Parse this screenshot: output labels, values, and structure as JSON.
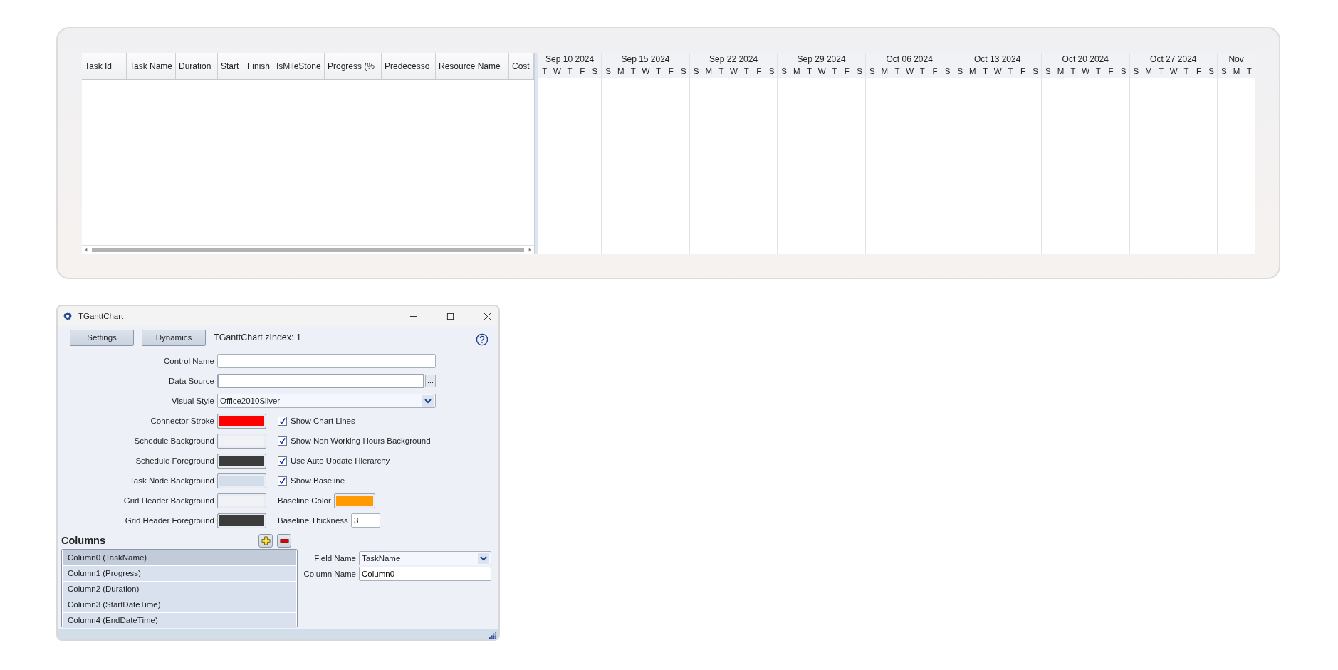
{
  "gantt": {
    "grid_columns": [
      {
        "label": "Task Id"
      },
      {
        "label": "Task Name"
      },
      {
        "label": "Duration"
      },
      {
        "label": "Start"
      },
      {
        "label": "Finish"
      },
      {
        "label": "IsMileStone"
      },
      {
        "label": "Progress (%"
      },
      {
        "label": "Predecesso"
      },
      {
        "label": "Resource Name"
      },
      {
        "label": "Cost"
      }
    ],
    "weeks": [
      {
        "label": "Sep 10 2024",
        "days": [
          "T",
          "W",
          "T",
          "F",
          "S"
        ]
      },
      {
        "label": "Sep 15 2024",
        "days": [
          "S",
          "M",
          "T",
          "W",
          "T",
          "F",
          "S"
        ]
      },
      {
        "label": "Sep 22 2024",
        "days": [
          "S",
          "M",
          "T",
          "W",
          "T",
          "F",
          "S"
        ]
      },
      {
        "label": "Sep 29 2024",
        "days": [
          "S",
          "M",
          "T",
          "W",
          "T",
          "F",
          "S"
        ]
      },
      {
        "label": "Oct 06 2024",
        "days": [
          "S",
          "M",
          "T",
          "W",
          "T",
          "F",
          "S"
        ]
      },
      {
        "label": "Oct 13 2024",
        "days": [
          "S",
          "M",
          "T",
          "W",
          "T",
          "F",
          "S"
        ]
      },
      {
        "label": "Oct 20 2024",
        "days": [
          "S",
          "M",
          "T",
          "W",
          "T",
          "F",
          "S"
        ]
      },
      {
        "label": "Oct 27 2024",
        "days": [
          "S",
          "M",
          "T",
          "W",
          "T",
          "F",
          "S"
        ]
      },
      {
        "label": "Nov",
        "days": [
          "S",
          "M",
          "T"
        ]
      }
    ]
  },
  "dialog": {
    "title": "TGanttChart",
    "buttons": [
      "Settings",
      "Dynamics"
    ],
    "info": "TGanttChart zIndex: 1",
    "fields": [
      {
        "kind": "text",
        "label": "Control Name"
      },
      {
        "kind": "browse",
        "label": "Data Source",
        "button": "..."
      },
      {
        "kind": "select",
        "label": "Visual Style",
        "value": "Office2010Silver"
      }
    ],
    "rows": [
      {
        "label": "Connector Stroke",
        "color": "#ff0000",
        "right": {
          "kind": "checkbox",
          "label": "Show Chart Lines",
          "checked": true
        }
      },
      {
        "label": "Schedule Background",
        "color": "#f0f2f5",
        "right": {
          "kind": "checkbox",
          "label": "Show Non Working Hours Background",
          "checked": true
        }
      },
      {
        "label": "Schedule Foreground",
        "color": "#3c3c3c",
        "right": {
          "kind": "checkbox",
          "label": "Use Auto Update Hierarchy",
          "checked": true
        }
      },
      {
        "label": "Task Node Background",
        "color": "#d3dde9",
        "right": {
          "kind": "checkbox",
          "label": "Show Baseline",
          "checked": true
        }
      },
      {
        "label": "Grid Header Background",
        "color": "#f0f2f5",
        "right": {
          "kind": "color",
          "label": "Baseline Color",
          "color": "#ff9a00"
        }
      },
      {
        "label": "Grid Header Foreground",
        "color": "#3c3c3c",
        "right": {
          "kind": "number",
          "label": "Baseline Thickness",
          "value": "3"
        }
      }
    ],
    "columns": {
      "title": "Columns",
      "items": [
        {
          "label": "Column0 (TaskName)",
          "selected": true
        },
        {
          "label": "Column1 (Progress)",
          "selected": false
        },
        {
          "label": "Column2 (Duration)",
          "selected": false
        },
        {
          "label": "Column3 (StartDateTime)",
          "selected": false
        },
        {
          "label": "Column4 (EndDateTime)",
          "selected": false
        }
      ],
      "field_name": {
        "label": "Field Name",
        "value": "TaskName"
      },
      "column_name": {
        "label": "Column Name",
        "value": "Column0"
      }
    }
  }
}
